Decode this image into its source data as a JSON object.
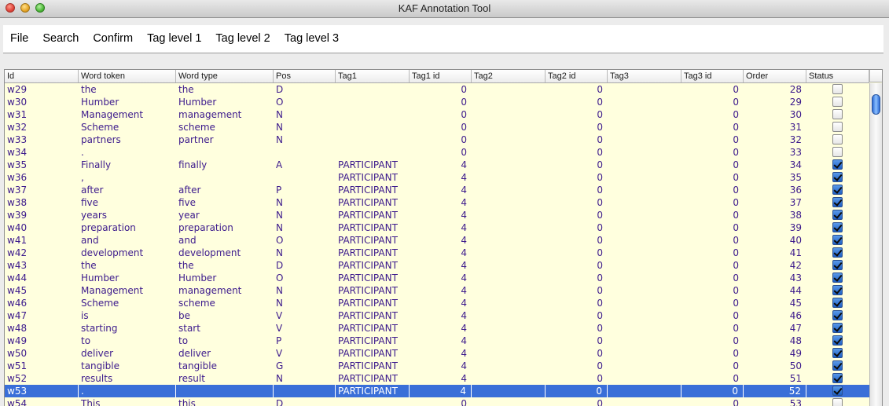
{
  "window": {
    "title": "KAF Annotation Tool"
  },
  "menu": {
    "items": [
      "File",
      "Search",
      "Confirm",
      "Tag level 1",
      "Tag level 2",
      "Tag level 3"
    ]
  },
  "table": {
    "columns": [
      "Id",
      "Word token",
      "Word type",
      "Pos",
      "Tag1",
      "Tag1 id",
      "Tag2",
      "Tag2 id",
      "Tag3",
      "Tag3 id",
      "Order",
      "Status"
    ],
    "selected_row": 24,
    "rows": [
      {
        "id": "w29",
        "token": "the",
        "type": "the",
        "pos": "D",
        "tag1": "",
        "tag1_id": "0",
        "tag2": "",
        "tag2_id": "0",
        "tag3": "",
        "tag3_id": "0",
        "order": "28",
        "status": false
      },
      {
        "id": "w30",
        "token": "Humber",
        "type": "Humber",
        "pos": "O",
        "tag1": "",
        "tag1_id": "0",
        "tag2": "",
        "tag2_id": "0",
        "tag3": "",
        "tag3_id": "0",
        "order": "29",
        "status": false
      },
      {
        "id": "w31",
        "token": "Management",
        "type": "management",
        "pos": "N",
        "tag1": "",
        "tag1_id": "0",
        "tag2": "",
        "tag2_id": "0",
        "tag3": "",
        "tag3_id": "0",
        "order": "30",
        "status": false
      },
      {
        "id": "w32",
        "token": "Scheme",
        "type": "scheme",
        "pos": "N",
        "tag1": "",
        "tag1_id": "0",
        "tag2": "",
        "tag2_id": "0",
        "tag3": "",
        "tag3_id": "0",
        "order": "31",
        "status": false
      },
      {
        "id": "w33",
        "token": "partners",
        "type": "partner",
        "pos": "N",
        "tag1": "",
        "tag1_id": "0",
        "tag2": "",
        "tag2_id": "0",
        "tag3": "",
        "tag3_id": "0",
        "order": "32",
        "status": false
      },
      {
        "id": "w34",
        "token": ".",
        "type": "",
        "pos": "",
        "tag1": "",
        "tag1_id": "0",
        "tag2": "",
        "tag2_id": "0",
        "tag3": "",
        "tag3_id": "0",
        "order": "33",
        "status": false
      },
      {
        "id": "w35",
        "token": "Finally",
        "type": "finally",
        "pos": "A",
        "tag1": "PARTICIPANT",
        "tag1_id": "4",
        "tag2": "",
        "tag2_id": "0",
        "tag3": "",
        "tag3_id": "0",
        "order": "34",
        "status": true
      },
      {
        "id": "w36",
        "token": ",",
        "type": "",
        "pos": "",
        "tag1": "PARTICIPANT",
        "tag1_id": "4",
        "tag2": "",
        "tag2_id": "0",
        "tag3": "",
        "tag3_id": "0",
        "order": "35",
        "status": true
      },
      {
        "id": "w37",
        "token": "after",
        "type": "after",
        "pos": "P",
        "tag1": "PARTICIPANT",
        "tag1_id": "4",
        "tag2": "",
        "tag2_id": "0",
        "tag3": "",
        "tag3_id": "0",
        "order": "36",
        "status": true
      },
      {
        "id": "w38",
        "token": "five",
        "type": "five",
        "pos": "N",
        "tag1": "PARTICIPANT",
        "tag1_id": "4",
        "tag2": "",
        "tag2_id": "0",
        "tag3": "",
        "tag3_id": "0",
        "order": "37",
        "status": true
      },
      {
        "id": "w39",
        "token": "years",
        "type": "year",
        "pos": "N",
        "tag1": "PARTICIPANT",
        "tag1_id": "4",
        "tag2": "",
        "tag2_id": "0",
        "tag3": "",
        "tag3_id": "0",
        "order": "38",
        "status": true
      },
      {
        "id": "w40",
        "token": "preparation",
        "type": "preparation",
        "pos": "N",
        "tag1": "PARTICIPANT",
        "tag1_id": "4",
        "tag2": "",
        "tag2_id": "0",
        "tag3": "",
        "tag3_id": "0",
        "order": "39",
        "status": true
      },
      {
        "id": "w41",
        "token": "and",
        "type": "and",
        "pos": "O",
        "tag1": "PARTICIPANT",
        "tag1_id": "4",
        "tag2": "",
        "tag2_id": "0",
        "tag3": "",
        "tag3_id": "0",
        "order": "40",
        "status": true
      },
      {
        "id": "w42",
        "token": "development",
        "type": "development",
        "pos": "N",
        "tag1": "PARTICIPANT",
        "tag1_id": "4",
        "tag2": "",
        "tag2_id": "0",
        "tag3": "",
        "tag3_id": "0",
        "order": "41",
        "status": true
      },
      {
        "id": "w43",
        "token": "the",
        "type": "the",
        "pos": "D",
        "tag1": "PARTICIPANT",
        "tag1_id": "4",
        "tag2": "",
        "tag2_id": "0",
        "tag3": "",
        "tag3_id": "0",
        "order": "42",
        "status": true
      },
      {
        "id": "w44",
        "token": "Humber",
        "type": "Humber",
        "pos": "O",
        "tag1": "PARTICIPANT",
        "tag1_id": "4",
        "tag2": "",
        "tag2_id": "0",
        "tag3": "",
        "tag3_id": "0",
        "order": "43",
        "status": true
      },
      {
        "id": "w45",
        "token": "Management",
        "type": "management",
        "pos": "N",
        "tag1": "PARTICIPANT",
        "tag1_id": "4",
        "tag2": "",
        "tag2_id": "0",
        "tag3": "",
        "tag3_id": "0",
        "order": "44",
        "status": true
      },
      {
        "id": "w46",
        "token": "Scheme",
        "type": "scheme",
        "pos": "N",
        "tag1": "PARTICIPANT",
        "tag1_id": "4",
        "tag2": "",
        "tag2_id": "0",
        "tag3": "",
        "tag3_id": "0",
        "order": "45",
        "status": true
      },
      {
        "id": "w47",
        "token": "is",
        "type": "be",
        "pos": "V",
        "tag1": "PARTICIPANT",
        "tag1_id": "4",
        "tag2": "",
        "tag2_id": "0",
        "tag3": "",
        "tag3_id": "0",
        "order": "46",
        "status": true
      },
      {
        "id": "w48",
        "token": "starting",
        "type": "start",
        "pos": "V",
        "tag1": "PARTICIPANT",
        "tag1_id": "4",
        "tag2": "",
        "tag2_id": "0",
        "tag3": "",
        "tag3_id": "0",
        "order": "47",
        "status": true
      },
      {
        "id": "w49",
        "token": "to",
        "type": "to",
        "pos": "P",
        "tag1": "PARTICIPANT",
        "tag1_id": "4",
        "tag2": "",
        "tag2_id": "0",
        "tag3": "",
        "tag3_id": "0",
        "order": "48",
        "status": true
      },
      {
        "id": "w50",
        "token": "deliver",
        "type": "deliver",
        "pos": "V",
        "tag1": "PARTICIPANT",
        "tag1_id": "4",
        "tag2": "",
        "tag2_id": "0",
        "tag3": "",
        "tag3_id": "0",
        "order": "49",
        "status": true
      },
      {
        "id": "w51",
        "token": "tangible",
        "type": "tangible",
        "pos": "G",
        "tag1": "PARTICIPANT",
        "tag1_id": "4",
        "tag2": "",
        "tag2_id": "0",
        "tag3": "",
        "tag3_id": "0",
        "order": "50",
        "status": true
      },
      {
        "id": "w52",
        "token": "results",
        "type": "result",
        "pos": "N",
        "tag1": "PARTICIPANT",
        "tag1_id": "4",
        "tag2": "",
        "tag2_id": "0",
        "tag3": "",
        "tag3_id": "0",
        "order": "51",
        "status": true
      },
      {
        "id": "w53",
        "token": ".",
        "type": "",
        "pos": "",
        "tag1": "PARTICIPANT",
        "tag1_id": "4",
        "tag2": "",
        "tag2_id": "0",
        "tag3": "",
        "tag3_id": "0",
        "order": "52",
        "status": true
      },
      {
        "id": "w54",
        "token": "This",
        "type": "this",
        "pos": "D",
        "tag1": "",
        "tag1_id": "0",
        "tag2": "",
        "tag2_id": "0",
        "tag3": "",
        "tag3_id": "0",
        "order": "53",
        "status": false
      }
    ]
  },
  "colors": {
    "cell_text": "#3c1a8c",
    "table_bg": "#ffffde",
    "selection": "#3a6fd8"
  }
}
